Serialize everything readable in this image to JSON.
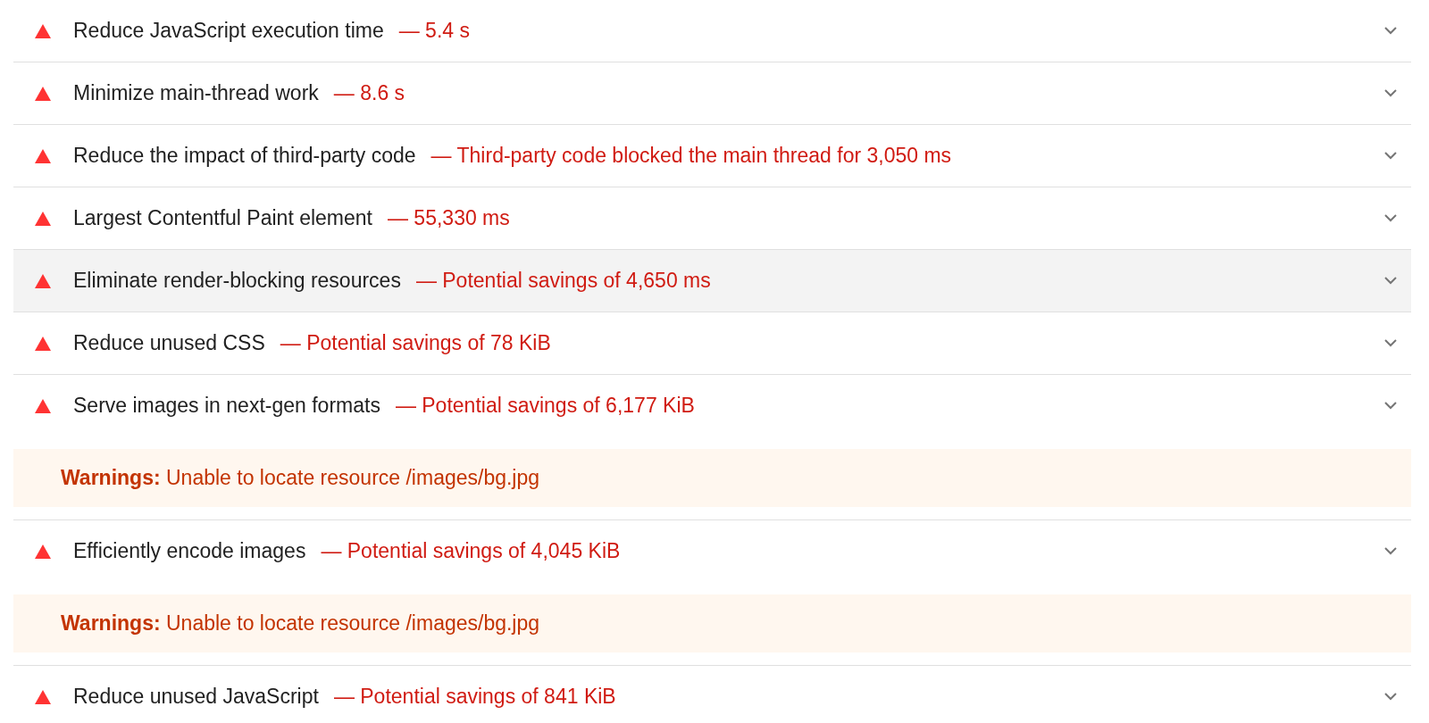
{
  "audits": [
    {
      "title": "Reduce JavaScript execution time",
      "value": "— 5.4 s",
      "highlighted": false
    },
    {
      "title": "Minimize main-thread work",
      "value": "— 8.6 s",
      "highlighted": false
    },
    {
      "title": "Reduce the impact of third-party code",
      "value": "— Third-party code blocked the main thread for 3,050 ms",
      "highlighted": false
    },
    {
      "title": "Largest Contentful Paint element",
      "value": "— 55,330 ms",
      "highlighted": false
    },
    {
      "title": "Eliminate render-blocking resources",
      "value": "— Potential savings of 4,650 ms",
      "highlighted": true
    },
    {
      "title": "Reduce unused CSS",
      "value": "— Potential savings of 78 KiB",
      "highlighted": false
    },
    {
      "title": "Serve images in next-gen formats",
      "value": "— Potential savings of 6,177 KiB",
      "highlighted": false,
      "warning": "**Warnings:** Unable to locate resource /images/bg.jpg"
    },
    {
      "title": "Efficiently encode images",
      "value": "— Potential savings of 4,045 KiB",
      "highlighted": false,
      "warning": "**Warnings:** Unable to locate resource /images/bg.jpg"
    },
    {
      "title": "Reduce unused JavaScript",
      "value": "— Potential savings of 841 KiB",
      "highlighted": false
    }
  ]
}
